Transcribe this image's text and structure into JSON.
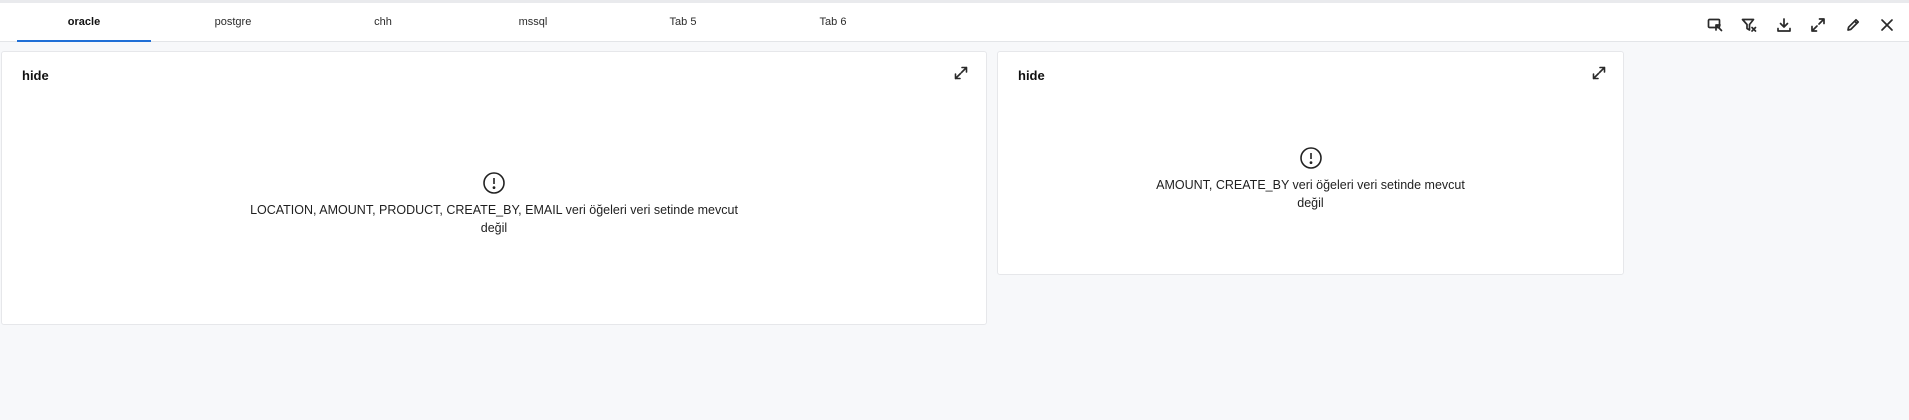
{
  "tabs": [
    {
      "label": "oracle",
      "active": true
    },
    {
      "label": "postgre",
      "active": false
    },
    {
      "label": "chh",
      "active": false
    },
    {
      "label": "mssql",
      "active": false
    },
    {
      "label": "Tab 5",
      "active": false
    },
    {
      "label": "Tab 6",
      "active": false
    }
  ],
  "toolbar": {
    "icons": [
      "select-cursor-icon",
      "filter-icon",
      "download-icon",
      "fullscreen-icon",
      "edit-icon",
      "close-icon"
    ]
  },
  "panels": [
    {
      "title": "hide",
      "message_line1": "LOCATION, AMOUNT, PRODUCT, CREATE_BY, EMAIL veri öğeleri veri setinde mevcut",
      "message_line2": "değil"
    },
    {
      "title": "hide",
      "message_line1": "AMOUNT, CREATE_BY veri öğeleri veri setinde mevcut",
      "message_line2": "değil"
    }
  ]
}
